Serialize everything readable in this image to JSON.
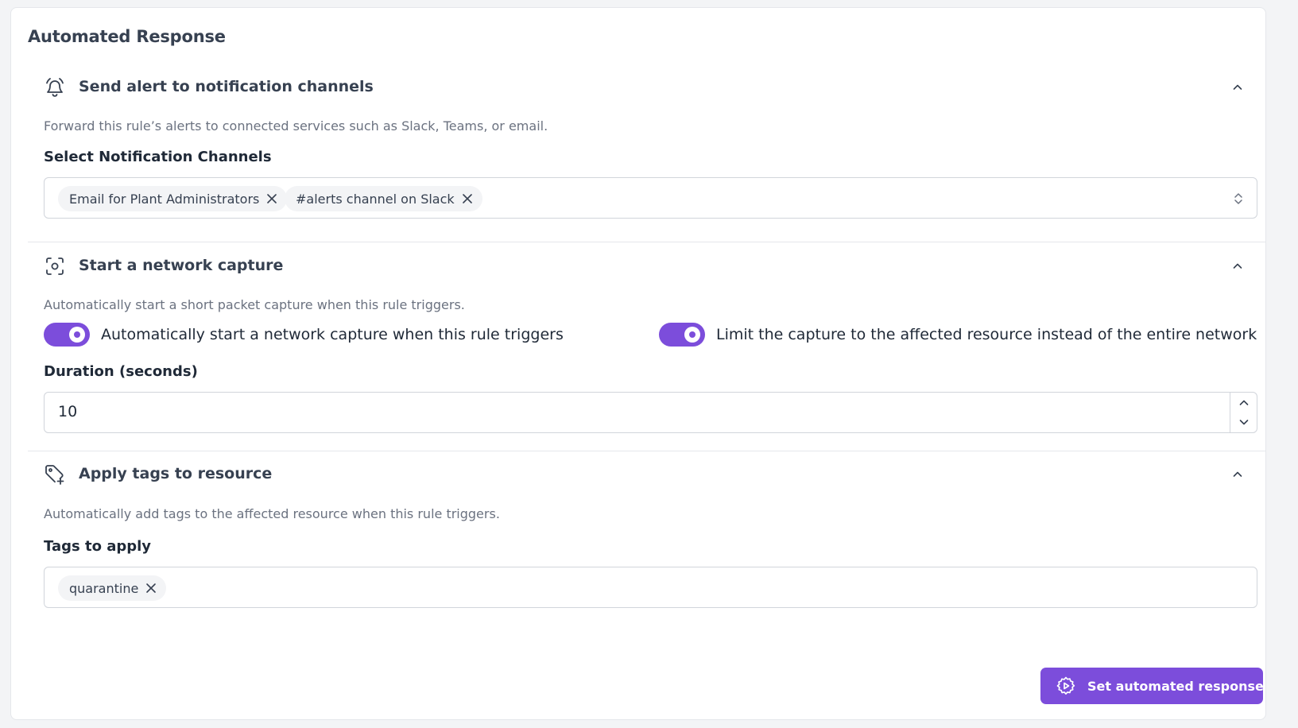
{
  "card": {
    "title": "Automated Response"
  },
  "notifications": {
    "title": "Send alert to notification channels",
    "description": "Forward this rule’s alerts to connected services such as Slack, Teams, or email.",
    "field_label": "Select Notification Channels",
    "selected": [
      "Email for Plant Administrators",
      "#alerts channel on Slack"
    ]
  },
  "capture": {
    "title": "Start a network capture",
    "description": "Automatically start a short packet capture when this rule triggers.",
    "toggle_auto_label": "Automatically start a network capture when this rule triggers",
    "toggle_auto_on": true,
    "toggle_limit_label": "Limit the capture to the affected resource instead of the entire network",
    "toggle_limit_on": true,
    "duration_label": "Duration (seconds)",
    "duration_value": "10"
  },
  "tags": {
    "title": "Apply tags to resource",
    "description": "Automatically add tags to the affected resource when this rule triggers.",
    "field_label": "Tags to apply",
    "selected": [
      "quarantine"
    ]
  },
  "action": {
    "submit_label": "Set automated response"
  },
  "icons": {
    "notifications": "bell-ring-icon",
    "capture": "scan-capture-icon",
    "tags": "tag-plus-icon",
    "collapse": "chevron-up-icon",
    "remove": "close-icon",
    "select": "chevron-up-down-icon",
    "submit": "gear-play-icon"
  },
  "colors": {
    "accent": "#7c4ddb",
    "chip_bg": "#f3f4f6",
    "muted_text": "#6b7280"
  }
}
